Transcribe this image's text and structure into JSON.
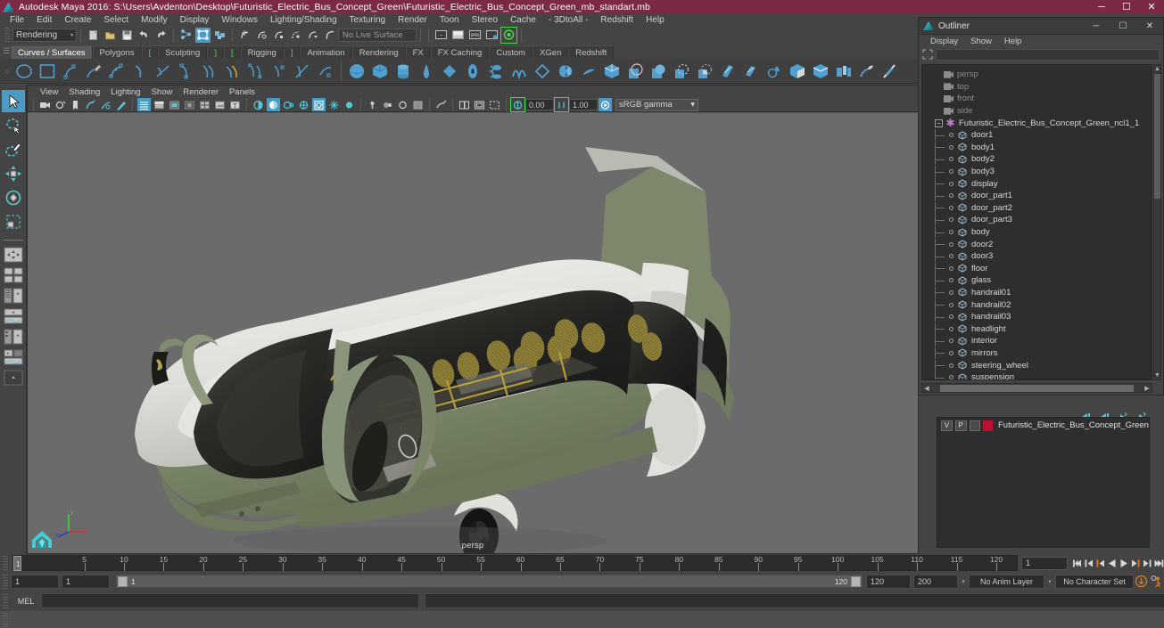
{
  "window": {
    "title": "Autodesk Maya 2016: S:\\Users\\Avdenton\\Desktop\\Futuristic_Electric_Bus_Concept_Green\\Futuristic_Electric_Bus_Concept_Green_mb_standart.mb",
    "app_icon": "maya-logo-icon",
    "minimize": "─",
    "maximize": "☐",
    "close": "✕",
    "accent_titlebar": "#7c2945"
  },
  "menubar": {
    "items": [
      "File",
      "Edit",
      "Create",
      "Select",
      "Modify",
      "Display",
      "Windows",
      "Lighting/Shading",
      "Texturing",
      "Render",
      "Toon",
      "Stereo",
      "Cache",
      "- 3DtoAll -",
      "Redshift",
      "Help"
    ]
  },
  "statusline": {
    "menu_set": "Rendering",
    "menu_set_arrow": "▾",
    "live_surface": "No Live Surface",
    "icons": [
      "new-scene-icon",
      "open-scene-icon",
      "save-scene-icon",
      "undo-icon",
      "redo-icon",
      "select-by-hierarchy-icon",
      "select-by-object-icon",
      "select-by-component-icon",
      "snap-to-grid-icon",
      "snap-to-curve-icon",
      "snap-to-point-icon",
      "snap-to-projected-center-icon",
      "snap-to-view-plane-icon",
      "make-live-icon",
      "show-render-view-icon",
      "render-current-frame-icon",
      "ipr-render-icon",
      "render-settings-icon",
      "redshift-render-icon"
    ]
  },
  "shelf": {
    "tabs": [
      {
        "label": "Curves / Surfaces",
        "active": true
      },
      {
        "label": "Polygons",
        "active": false
      },
      {
        "label": "[",
        "bracket": true
      },
      {
        "label": "Sculpting",
        "active": false
      },
      {
        "label": "]",
        "bracket": true
      },
      {
        "label": "[",
        "bracket": true
      },
      {
        "label": "Rigging",
        "active": false
      },
      {
        "label": "]",
        "bracket": true
      },
      {
        "label": "Animation",
        "active": false
      },
      {
        "label": "Rendering",
        "active": false
      },
      {
        "label": "FX",
        "active": false
      },
      {
        "label": "FX Caching",
        "active": false
      },
      {
        "label": "Custom",
        "active": false
      },
      {
        "label": "XGen",
        "active": false
      },
      {
        "label": "Redshift",
        "active": false
      }
    ],
    "icon_color": "#4f9fd0",
    "icon_color_alt": "#c8a53c",
    "items_curves": [
      "nurbs-circle-icon",
      "nurbs-square-icon",
      "ep-curve-icon",
      "pencil-curve-icon",
      "bezier-curve-icon",
      "curve-tool-icon",
      "arc-three-point-icon",
      "curve-edit-icon",
      "offset-curve-icon",
      "curve-fillet-icon",
      "attach-curve-icon",
      "detach-curve-icon",
      "align-curve-icon",
      "rebuild-curve-icon"
    ],
    "items_surfaces": [
      "nurbs-sphere-icon",
      "nurbs-cube-icon",
      "nurbs-cylinder-icon",
      "nurbs-cone-icon",
      "nurbs-plane-icon",
      "nurbs-torus-icon",
      "nurbs-circle-surface-icon",
      "nurbs-square-surface-icon",
      "revolve-icon",
      "loft-icon",
      "planar-icon",
      "extrude-icon",
      "birail-icon",
      "boundary-icon",
      "square-surface-icon",
      "bevel-icon",
      "bevel-plus-icon",
      "intersect-surfaces-icon",
      "project-curve-icon",
      "trim-tool-icon",
      "untrim-surfaces-icon",
      "booleans-icon",
      "attach-surfaces-icon",
      "detach-surfaces-icon",
      "align-surfaces-icon",
      "rebuild-surfaces-icon",
      "sculpt-geometry-icon",
      "surface-editing-icon"
    ]
  },
  "toolbox": {
    "tools": [
      {
        "name": "select-tool",
        "active": true
      },
      {
        "name": "lasso-select-tool",
        "active": false
      },
      {
        "name": "paint-select-tool",
        "active": false
      },
      {
        "name": "move-tool",
        "active": false
      },
      {
        "name": "rotate-tool",
        "active": false
      },
      {
        "name": "scale-tool",
        "active": false
      }
    ],
    "layouts": [
      "single-perspective-layout",
      "four-view-layout",
      "outliner-persp-layout",
      "persp-graph-layout",
      "hypershade-persp-layout",
      "persp-render-layout",
      "two-stacked-layout"
    ]
  },
  "viewport": {
    "menus": [
      "View",
      "Shading",
      "Lighting",
      "Show",
      "Renderer",
      "Panels"
    ],
    "camera_label": "persp",
    "exposure_value": "0.00",
    "gamma_value": "1.00",
    "color_management": "sRGB gamma",
    "color_management_arrow": "▾",
    "background_color": "#6b6b6b",
    "toolbar_icons": [
      "select-camera-icon",
      "camera-attributes-icon",
      "bookmarks-icon",
      "image-plane-icon",
      "2d-pan-zoom-icon",
      "grease-pencil-icon",
      "wireframe-icon",
      "smooth-shade-all-icon",
      "smooth-shade-selected-icon",
      "flat-shade-icon",
      "shaded-wireframe-icon",
      "textured-icon",
      "use-lights-icon",
      "shadows-icon",
      "screen-space-ao-icon",
      "motion-blur-icon",
      "multisample-icon",
      "depth-of-field-icon",
      "isolate-select-icon",
      "xray-icon",
      "xray-joints-icon",
      "xray-active-components-icon",
      "exposure-icon",
      "gamma-icon",
      "color-management-icon"
    ],
    "model": {
      "name": "Futuristic Electric Bus Concept Green",
      "body_color": "#7d8a6e",
      "roof_color": "#e3e3df",
      "glass_color": "#1d1d1a",
      "seat_color": "#9a8a3c",
      "wheel_color": "#121212"
    },
    "axis_gizmo": {
      "x": "x",
      "y": "y",
      "z": "z",
      "x_color": "#d83030",
      "y_color": "#3ad83a",
      "z_color": "#3838d8"
    }
  },
  "outliner": {
    "title": "Outliner",
    "icon": "maya-window-icon",
    "minimize": "─",
    "maximize": "☐",
    "close": "✕",
    "menus": [
      "Display",
      "Show",
      "Help"
    ],
    "search_placeholder": "",
    "search_icon": "filter-icon",
    "cameras": [
      {
        "label": "persp",
        "icon": "camera-icon"
      },
      {
        "label": "top",
        "icon": "camera-icon"
      },
      {
        "label": "front",
        "icon": "camera-icon"
      },
      {
        "label": "side",
        "icon": "camera-icon"
      }
    ],
    "group": {
      "label": "Futuristic_Electric_Bus_Concept_Green_ncl1_1",
      "icon": "nucleus-star-icon",
      "expander": "−"
    },
    "children": [
      {
        "label": "door1",
        "icon": "mesh-icon"
      },
      {
        "label": "body1",
        "icon": "mesh-icon"
      },
      {
        "label": "body2",
        "icon": "mesh-icon"
      },
      {
        "label": "body3",
        "icon": "mesh-icon"
      },
      {
        "label": "display",
        "icon": "mesh-icon"
      },
      {
        "label": "door_part1",
        "icon": "mesh-icon"
      },
      {
        "label": "door_part2",
        "icon": "mesh-icon"
      },
      {
        "label": "door_part3",
        "icon": "mesh-icon"
      },
      {
        "label": "body",
        "icon": "mesh-icon"
      },
      {
        "label": "door2",
        "icon": "mesh-icon"
      },
      {
        "label": "door3",
        "icon": "mesh-icon"
      },
      {
        "label": "floor",
        "icon": "mesh-icon"
      },
      {
        "label": "glass",
        "icon": "mesh-icon"
      },
      {
        "label": "handrail01",
        "icon": "mesh-icon"
      },
      {
        "label": "handrail02",
        "icon": "mesh-icon"
      },
      {
        "label": "handrail03",
        "icon": "mesh-icon"
      },
      {
        "label": "headlight",
        "icon": "mesh-icon"
      },
      {
        "label": "interior",
        "icon": "mesh-icon"
      },
      {
        "label": "mirrors",
        "icon": "mesh-icon"
      },
      {
        "label": "steering_wheel",
        "icon": "mesh-icon"
      },
      {
        "label": "suspension",
        "icon": "mesh-icon"
      }
    ],
    "scroll_up": "▲",
    "scroll_down": "▼",
    "scroll_left": "◀",
    "scroll_right": "▶"
  },
  "layer_editor": {
    "buttons": [
      "layer-first-icon",
      "layer-prev-icon",
      "layer-next-icon",
      "layer-new-icon"
    ],
    "layers": [
      {
        "visibility": "V",
        "playback": "P",
        "type": "",
        "color": "#c01030",
        "name": "Futuristic_Electric_Bus_Concept_Green"
      }
    ]
  },
  "time_slider": {
    "ticks": [
      5,
      10,
      15,
      20,
      25,
      30,
      35,
      40,
      45,
      50,
      55,
      60,
      65,
      70,
      75,
      80,
      85,
      90,
      95,
      100,
      105,
      110,
      115,
      120
    ],
    "current_frame": "1",
    "current_frame_field": "1",
    "playback_buttons": [
      "go-to-start-icon",
      "step-back-keyframe-icon",
      "step-back-frame-icon",
      "play-backwards-icon",
      "play-forwards-icon",
      "step-forward-frame-icon",
      "step-forward-keyframe-icon",
      "go-to-end-icon"
    ]
  },
  "range_slider": {
    "start_field": "1",
    "start_playback_field": "1",
    "range_start_label": "1",
    "range_end_label": "120",
    "end_playback_field": "120",
    "end_field": "200",
    "anim_layer": "No Anim Layer",
    "character_set": "No Character Set",
    "dropdown_arrow": "▾",
    "auto_key_icon": "auto-keyframe-icon",
    "anim_prefs_icon": "animation-preferences-icon"
  },
  "command_line": {
    "language": "MEL",
    "input_value": "",
    "result_value": ""
  }
}
